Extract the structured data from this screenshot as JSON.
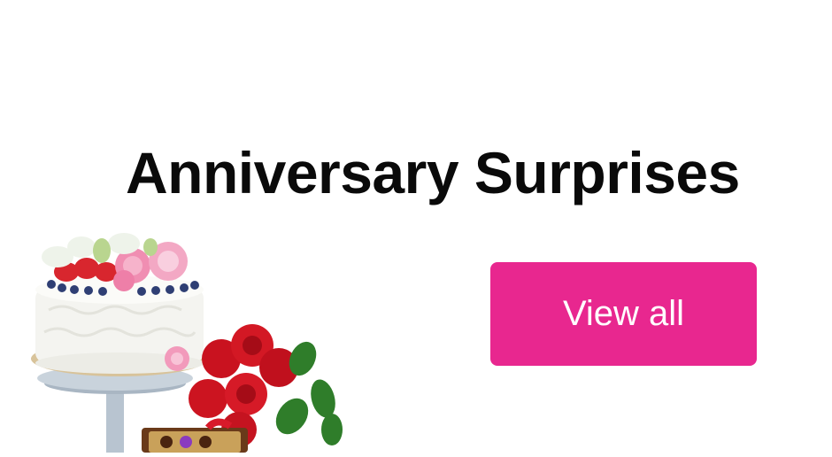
{
  "section": {
    "title": "Anniversary Surprises",
    "view_all_label": "View all"
  },
  "colors": {
    "accent": "#e8278f",
    "title_text": "#0a0a0a",
    "background": "#ffffff"
  },
  "image": {
    "description_icon": "cake-roses-chocolates-icon"
  }
}
